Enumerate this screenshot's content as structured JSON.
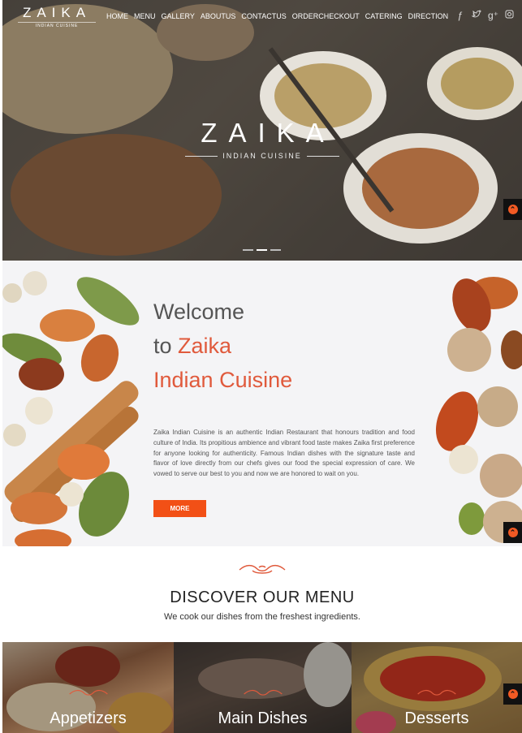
{
  "brand": {
    "name": "ZAIKA",
    "tagline": "INDIAN CUISINE"
  },
  "nav": {
    "items": [
      "HOME",
      "MENU",
      "GALLERY",
      "ABOUTUS",
      "CONTACTUS",
      "ORDERCHECKOUT",
      "CATERING",
      "DIRECTION"
    ]
  },
  "social": [
    "facebook-icon",
    "twitter-icon",
    "google-plus-icon",
    "instagram-icon"
  ],
  "hero": {
    "logo": "ZAIKA",
    "tagline": "INDIAN CUISINE",
    "slides": 3,
    "active_slide": 2
  },
  "welcome": {
    "line1": "Welcome",
    "line2_prefix": "to ",
    "line2_brand": "Zaika",
    "line3": "Indian Cuisine",
    "body": "Zaika Indian Cuisine is an authentic Indian Restaurant that honours tradition and food culture of India. Its propitious ambience and vibrant food taste makes Zaika first preference for anyone looking for authenticity. Famous Indian dishes with the signature taste and flavor of love directly from our chefs gives our food the special expression of care. We vowed to serve our best to you and now we are honored to wait on you.",
    "button": "MORE"
  },
  "discover": {
    "title": "DISCOVER OUR MENU",
    "subtitle": "We cook our dishes from the freshest ingredients."
  },
  "tiles": [
    {
      "label": "Appetizers"
    },
    {
      "label": "Main Dishes"
    },
    {
      "label": "Desserts"
    }
  ],
  "colors": {
    "accent": "#e05a3c",
    "button": "#f25016",
    "totop": "#f15a24"
  }
}
